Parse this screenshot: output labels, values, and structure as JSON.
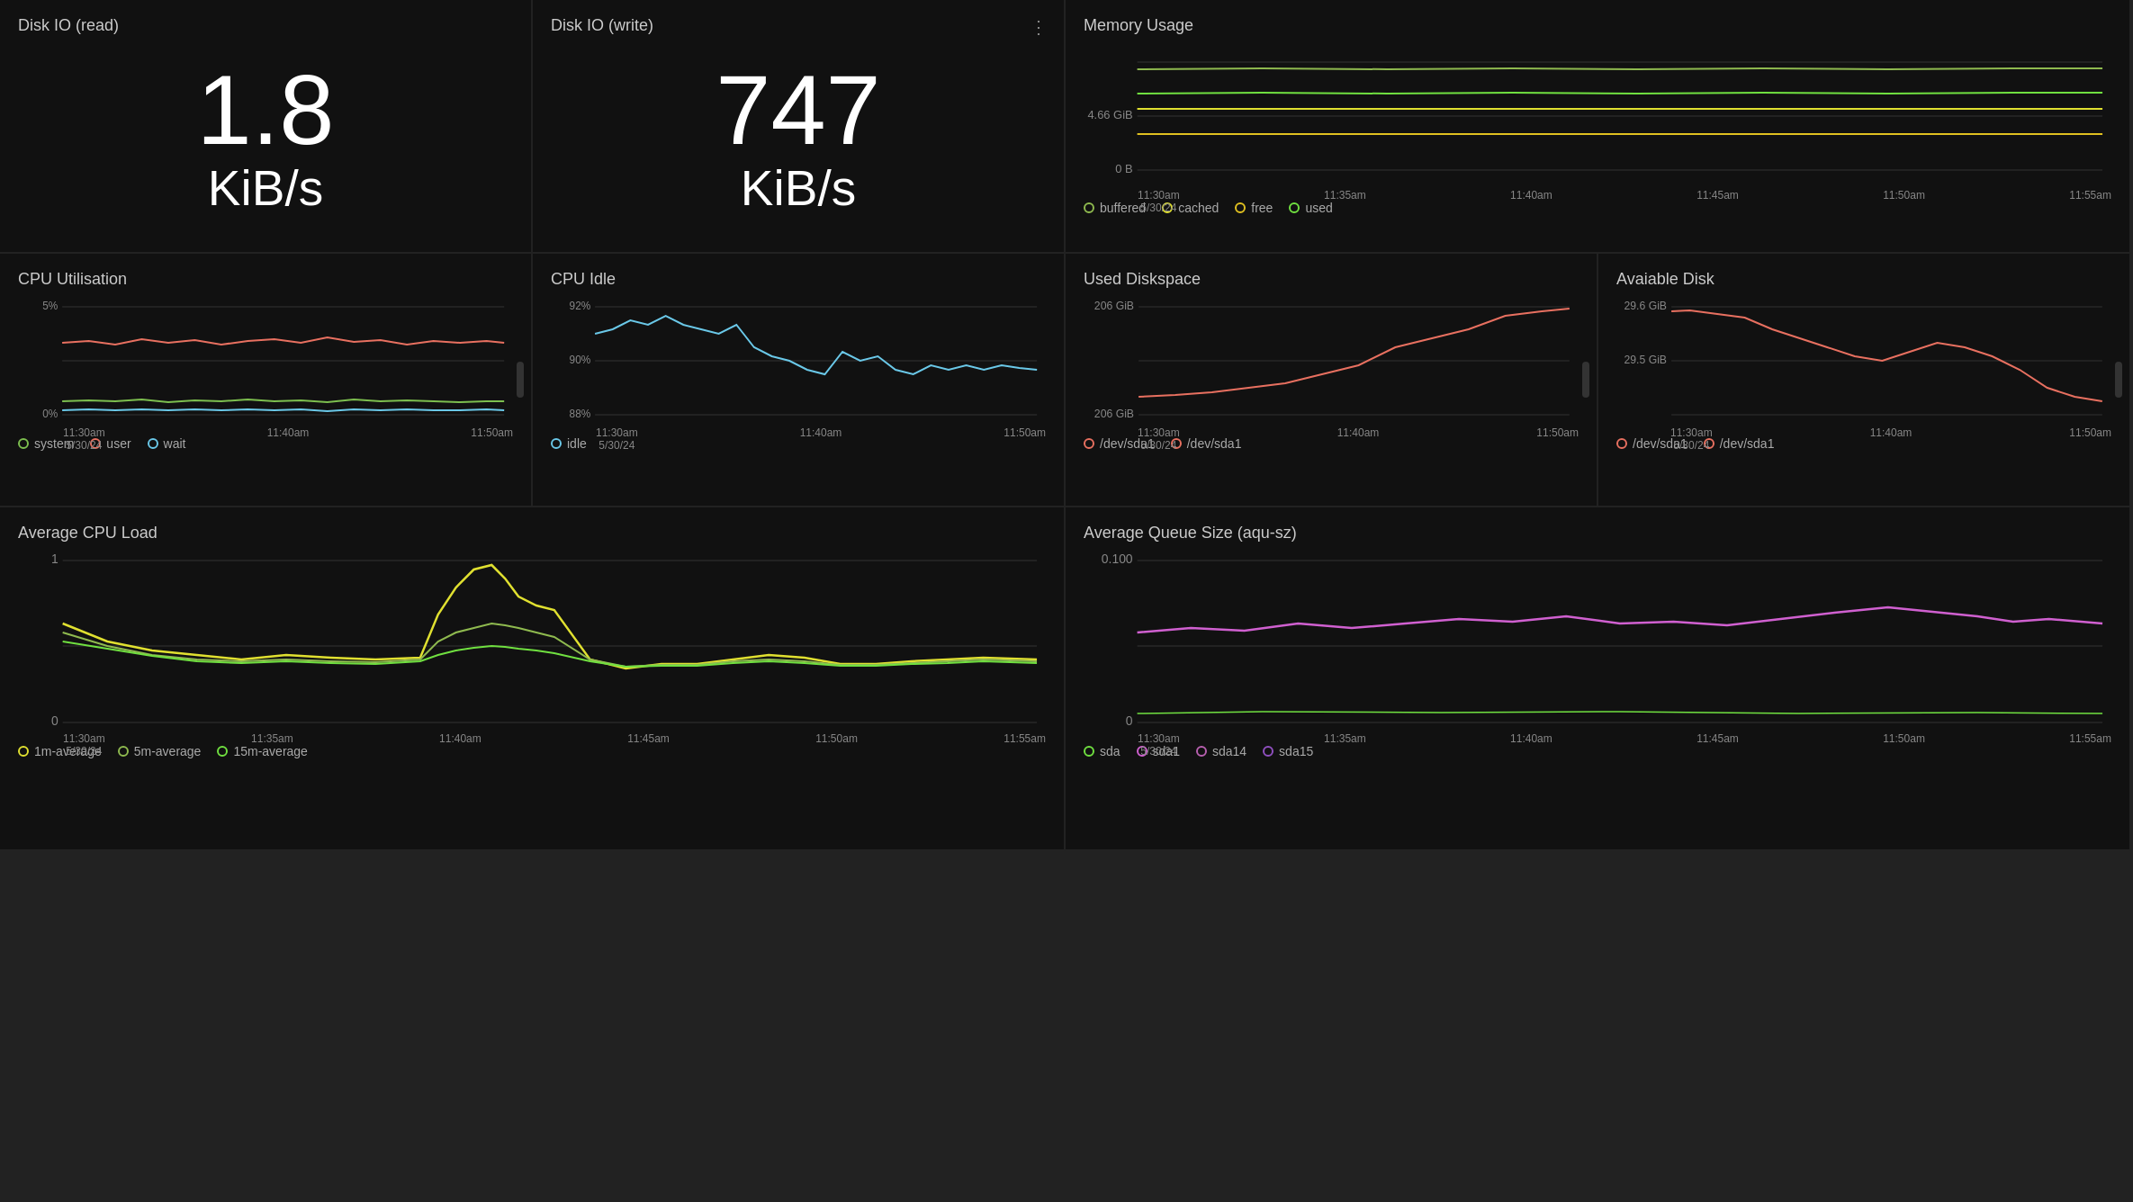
{
  "panels": {
    "disk_io_read": {
      "title": "Disk IO (read)",
      "value": "1.8",
      "unit": "KiB/s"
    },
    "disk_io_write": {
      "title": "Disk IO (write)",
      "value": "747",
      "unit": "KiB/s",
      "more_icon": "⋮"
    },
    "memory_usage": {
      "title": "Memory Usage",
      "y_labels": [
        "4.66 GiB",
        "0 B"
      ],
      "x_labels": [
        "11:30am\n5/30/24",
        "11:35am",
        "11:40am",
        "11:45am",
        "11:50am",
        "11:55am"
      ],
      "legend": [
        {
          "label": "buffered",
          "color": "#8fba4f"
        },
        {
          "label": "cached",
          "color": "#e0e030"
        },
        {
          "label": "free",
          "color": "#e0c020"
        },
        {
          "label": "used",
          "color": "#70e040"
        }
      ]
    },
    "cpu_utilisation": {
      "title": "CPU Utilisation",
      "y_labels": [
        "5%",
        "0%"
      ],
      "x_labels": [
        "11:30am\n5/30/24",
        "11:40am",
        "11:50am"
      ],
      "legend": [
        {
          "label": "system",
          "color": "#7dbf4f"
        },
        {
          "label": "user",
          "color": "#e87060"
        },
        {
          "label": "wait",
          "color": "#6ac8e8"
        }
      ]
    },
    "cpu_idle": {
      "title": "CPU Idle",
      "y_labels": [
        "92%",
        "90%",
        "88%"
      ],
      "x_labels": [
        "11:30am\n5/30/24",
        "11:40am",
        "11:50am"
      ],
      "legend": [
        {
          "label": "idle",
          "color": "#6ac8e8"
        }
      ]
    },
    "used_diskspace": {
      "title": "Used Diskspace",
      "y_labels": [
        "206 GiB",
        "206 GiB"
      ],
      "x_labels": [
        "11:30am\n5/30/24",
        "11:40am",
        "11:50am"
      ],
      "legend": [
        {
          "label": "/dev/sda1",
          "color": "#e87060"
        },
        {
          "label": "/dev/sda1",
          "color": "#e87060"
        }
      ]
    },
    "available_disk": {
      "title": "Avaiable Disk",
      "y_labels": [
        "29.6 GiB",
        "29.5 GiB"
      ],
      "x_labels": [
        "11:30am\n5/30/24",
        "11:40am",
        "11:50am"
      ],
      "legend": [
        {
          "label": "/dev/sda1",
          "color": "#e87060"
        },
        {
          "label": "/dev/sda1",
          "color": "#e87060"
        }
      ]
    },
    "avg_cpu_load": {
      "title": "Average CPU Load",
      "y_labels": [
        "1",
        "0"
      ],
      "x_labels": [
        "11:30am\n5/30/24",
        "11:35am",
        "11:40am",
        "11:45am",
        "11:50am",
        "11:55am"
      ],
      "legend": [
        {
          "label": "1m-average",
          "color": "#e0e030"
        },
        {
          "label": "5m-average",
          "color": "#8fba4f"
        },
        {
          "label": "15m-average",
          "color": "#70e040"
        }
      ]
    },
    "avg_queue_size": {
      "title": "Average Queue Size (aqu-sz)",
      "y_labels": [
        "0.100",
        "0"
      ],
      "x_labels": [
        "11:30am\n5/30/24",
        "11:35am",
        "11:40am",
        "11:45am",
        "11:50am",
        "11:55am"
      ],
      "legend": [
        {
          "label": "sda",
          "color": "#70e040"
        },
        {
          "label": "sda1",
          "color": "#d060d0"
        },
        {
          "label": "sda14",
          "color": "#b860b0"
        },
        {
          "label": "sda15",
          "color": "#9050c0"
        }
      ]
    }
  }
}
